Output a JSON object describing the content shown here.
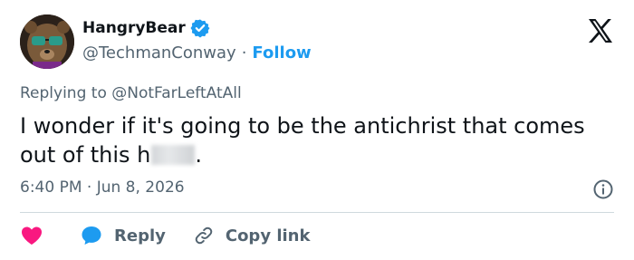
{
  "user": {
    "display_name": "HangryBear",
    "handle": "@TechmanConway",
    "separator": "·",
    "follow_label": "Follow"
  },
  "reply_context": {
    "prefix": "Replying to",
    "mention": "@NotFarLeftAtAll"
  },
  "tweet": {
    "text_before_blur": "I wonder if it's going to be the antichrist that comes out of this h",
    "text_after_blur": "."
  },
  "meta": {
    "time": "6:40 PM",
    "separator": "·",
    "date": "Jun 8, 2026"
  },
  "actions": {
    "reply_label": "Reply",
    "copy_link_label": "Copy link"
  },
  "colors": {
    "accent": "#1d9bf0",
    "like": "#f91880",
    "muted": "#536471",
    "text": "#0f1419"
  },
  "icons": [
    "verified-badge-icon",
    "x-logo-icon",
    "info-icon",
    "heart-icon",
    "reply-bubble-icon",
    "link-icon"
  ]
}
